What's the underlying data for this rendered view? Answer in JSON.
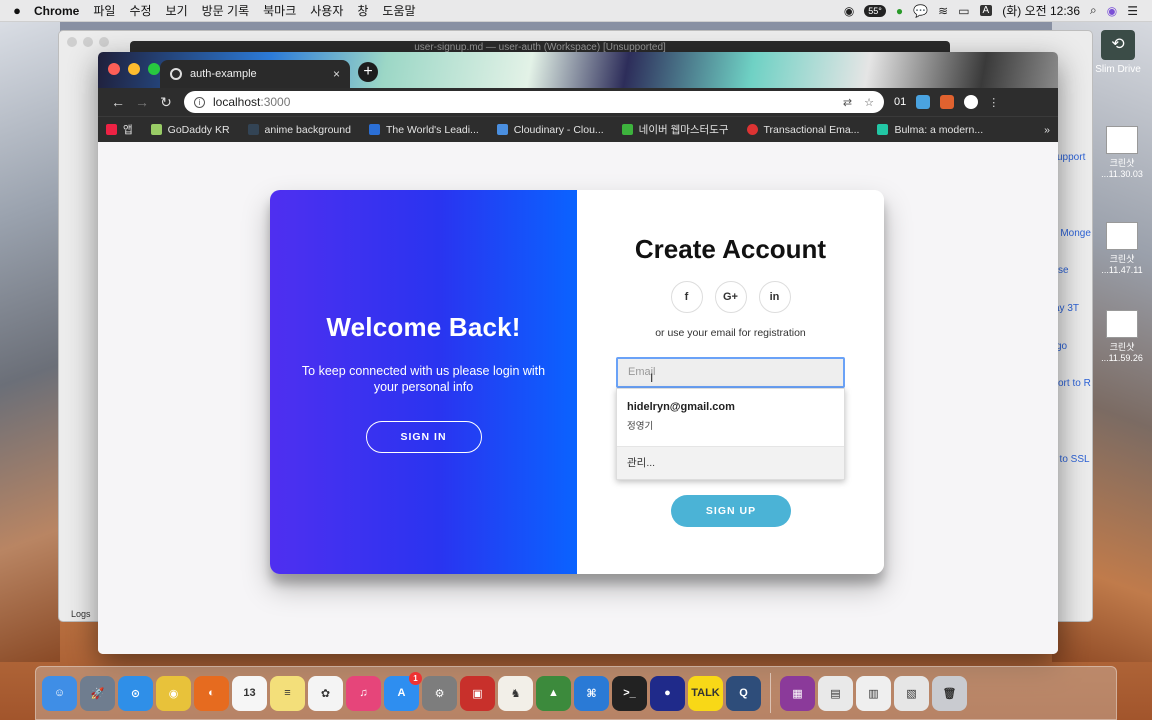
{
  "menubar": {
    "apple": "",
    "app": "Chrome",
    "items": [
      "파일",
      "수정",
      "보기",
      "방문 기록",
      "북마크",
      "사용자",
      "창",
      "도움말"
    ],
    "temperature": "55°",
    "clock": "(화) 오전 12:36",
    "input_indicator": "A"
  },
  "background": {
    "editor_title": "user-signup.md — user-auth (Workspace) [Unsupported]",
    "logs_label": "Logs",
    "drive_label": "Slim Drive",
    "side_links": [
      "support",
      "n Monge",
      "se",
      "ay 3T",
      "go",
      "ort to R",
      "t to SSL"
    ],
    "screenshots": [
      "크린샷\n...11.30.03",
      "크린샷\n...11.47.11",
      "크린샷\n...11.59.26"
    ]
  },
  "browser": {
    "tab_title": "auth-example",
    "tab_close": "×",
    "new_tab": "+",
    "url_host": "localhost",
    "url_port": ":3000",
    "bookmarks": [
      "앱",
      "GoDaddy KR",
      "anime background",
      "The World's Leadi...",
      "Cloudinary - Clou...",
      "네이버 웹마스터도구",
      "Transactional Ema...",
      "Bulma: a modern..."
    ],
    "bookmarks_more": "»",
    "ext_badge": "01"
  },
  "auth": {
    "overlay": {
      "title": "Welcome Back!",
      "text": "To keep connected with us please login with your personal info",
      "button": "SIGN IN"
    },
    "form": {
      "title": "Create Account",
      "social": [
        "f",
        "G+",
        "in"
      ],
      "hint": "or use your email for registration",
      "email_placeholder": "Email",
      "autofill_email": "hidelryn@gmail.com",
      "autofill_name": "정영기",
      "autofill_manage": "관리...",
      "button": "SIGN UP"
    }
  },
  "dock": {
    "apps": [
      {
        "name": "finder",
        "color": "#3f8ee6",
        "glyph": "☺"
      },
      {
        "name": "launchpad",
        "color": "#6f7d8f",
        "glyph": "🚀"
      },
      {
        "name": "safari",
        "color": "#2f8fe8",
        "glyph": "⊙"
      },
      {
        "name": "chrome",
        "color": "#e8c23a",
        "glyph": "◉"
      },
      {
        "name": "firefox",
        "color": "#e66b1f",
        "glyph": "◐"
      },
      {
        "name": "calendar",
        "color": "#f6f6f6",
        "glyph": "13"
      },
      {
        "name": "notes",
        "color": "#f3df7a",
        "glyph": "≡"
      },
      {
        "name": "photos",
        "color": "#f4f4f4",
        "glyph": "✿"
      },
      {
        "name": "itunes",
        "color": "#e6457a",
        "glyph": "♫"
      },
      {
        "name": "app-store",
        "color": "#2e8ef0",
        "glyph": "A",
        "badge": "1"
      },
      {
        "name": "system-preferences",
        "color": "#7d7d7d",
        "glyph": "⚙"
      },
      {
        "name": "redis",
        "color": "#c8302b",
        "glyph": "▣"
      },
      {
        "name": "sequel",
        "color": "#f2efe8",
        "glyph": "♞"
      },
      {
        "name": "robo",
        "color": "#3c8a3c",
        "glyph": "▲"
      },
      {
        "name": "vscode",
        "color": "#2a7ad6",
        "glyph": "⌘"
      },
      {
        "name": "terminal",
        "color": "#222222",
        "glyph": ">_"
      },
      {
        "name": "moon",
        "color": "#1f2a8a",
        "glyph": "●"
      },
      {
        "name": "kakaotalk",
        "color": "#f8d817",
        "glyph": "TALK"
      },
      {
        "name": "quicktime",
        "color": "#2e4d7a",
        "glyph": "Q"
      },
      {
        "name": "screenshot-1",
        "color": "#8b3a9a",
        "glyph": "▦"
      },
      {
        "name": "screenshot-2",
        "color": "#e9e9e9",
        "glyph": "▤"
      },
      {
        "name": "screenshot-3",
        "color": "#efefef",
        "glyph": "▥"
      },
      {
        "name": "screenshot-4",
        "color": "#e6e6e6",
        "glyph": "▧"
      },
      {
        "name": "trash",
        "color": "#c9cbd0",
        "glyph": "🗑"
      }
    ]
  }
}
